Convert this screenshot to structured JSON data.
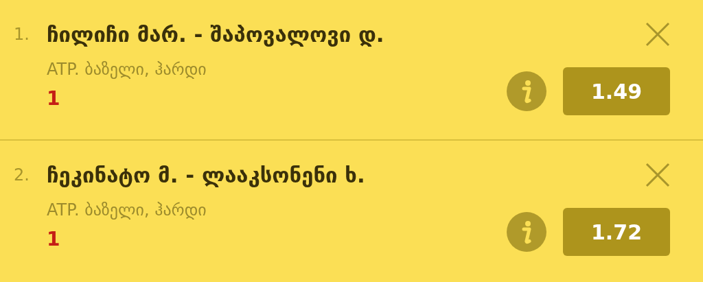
{
  "bets": [
    {
      "index": "1.",
      "title": "ჩილიჩი მარ. - შაპოვალოვი დ.",
      "subtitle": "ATP. ბაზელი, ჰარდი",
      "pick": "1",
      "odds": "1.49"
    },
    {
      "index": "2.",
      "title": "ჩეკინატო მ. - ლააკსონენი ხ.",
      "subtitle": "ATP. ბაზელი, ჰარდი",
      "pick": "1",
      "odds": "1.72"
    }
  ]
}
